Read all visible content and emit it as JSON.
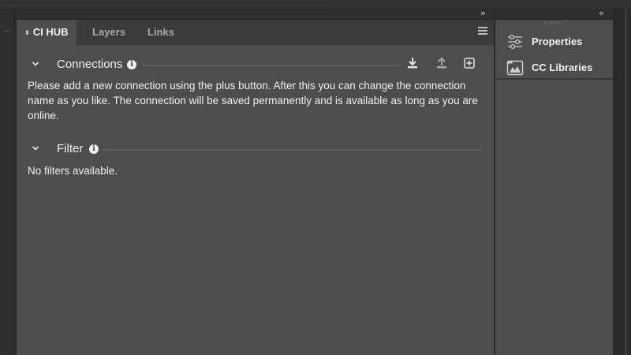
{
  "panel": {
    "tabs": [
      {
        "label": "CI HUB",
        "active": true
      },
      {
        "label": "Layers",
        "active": false
      },
      {
        "label": "Links",
        "active": false
      }
    ]
  },
  "connections": {
    "title": "Connections",
    "description": "Please add a new connection using the plus button. After this you can change the connection name as you like. The connection will be saved permanently and is available as long as you are online."
  },
  "filter": {
    "title": "Filter",
    "empty_text": "No filters available."
  },
  "dock": {
    "items": [
      {
        "label": "Properties",
        "icon": "properties-sliders-icon"
      },
      {
        "label": "CC Libraries",
        "icon": "cc-libraries-icon"
      }
    ]
  },
  "icons": {
    "expand": "double-chevron-right-icon",
    "collapse": "double-chevron-left-icon",
    "panel_menu": "hamburger-menu-icon",
    "download": "download-icon",
    "upload": "upload-icon",
    "add": "add-connection-icon",
    "info": "info-icon"
  },
  "colors": {
    "panel_bg": "#4d4d4d",
    "tabbar_bg": "#3b3b3b",
    "app_bg": "#2b2b2b",
    "text": "#f0f0f0"
  }
}
